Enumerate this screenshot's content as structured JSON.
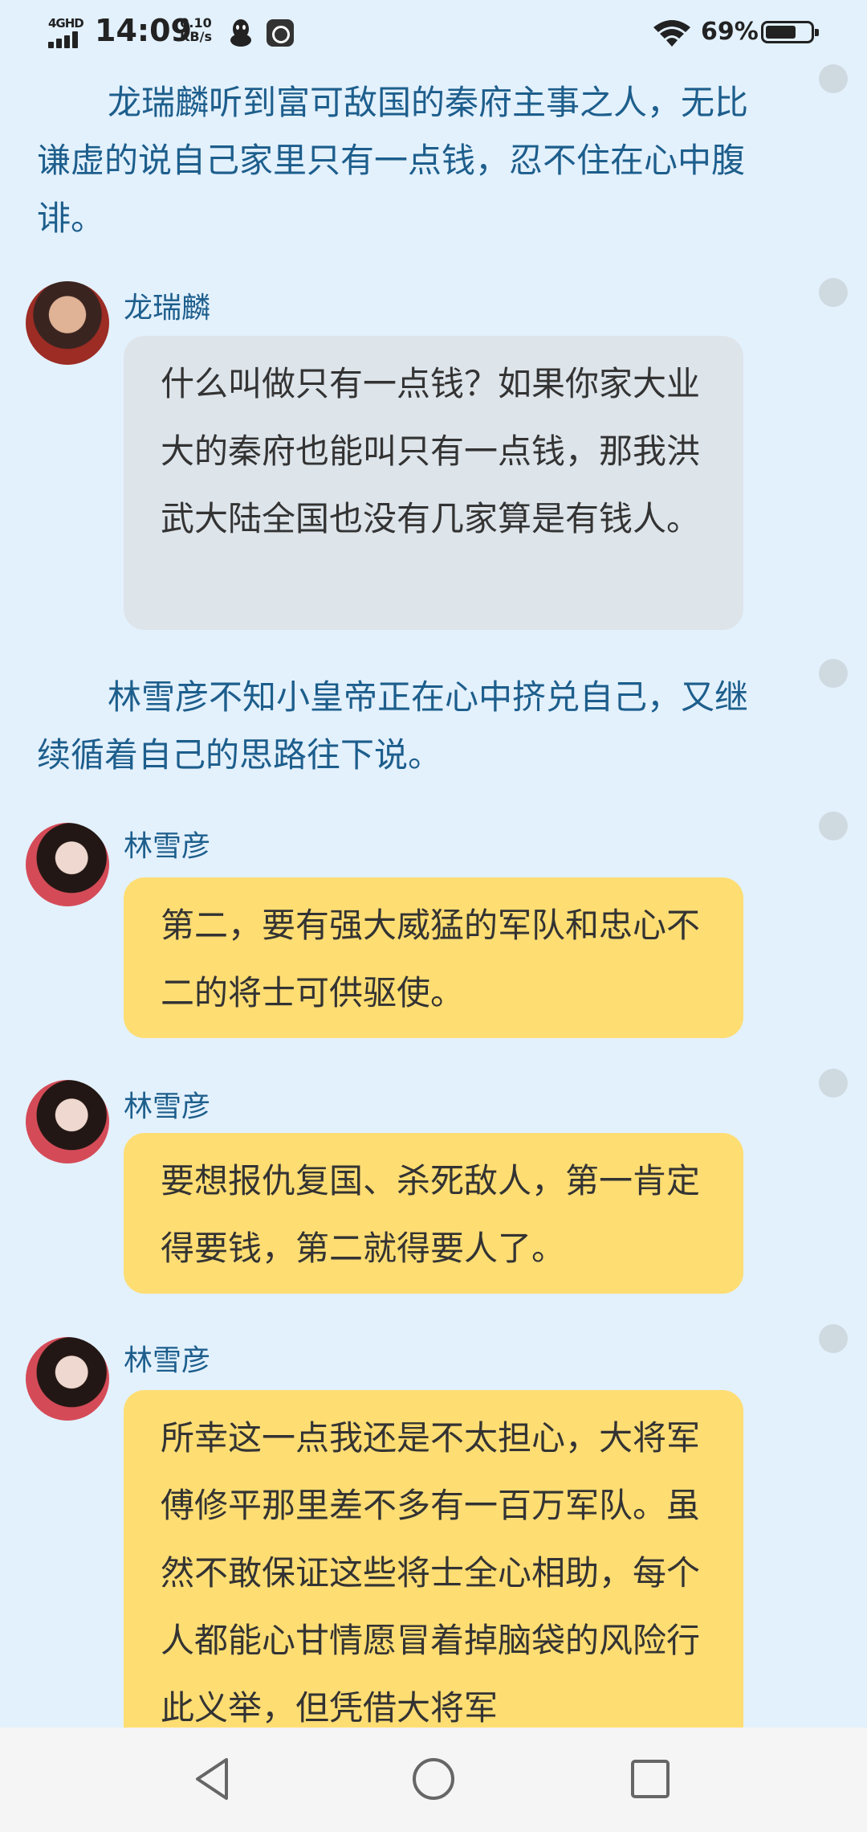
{
  "status_bar": {
    "network": "4GHD",
    "time": "14:09",
    "speed_value": "0.10",
    "speed_unit": "KB/s",
    "battery_percent": "69%",
    "battery_level": 0.69,
    "icons": [
      "signal-icon",
      "qq-icon",
      "app-notification-icon",
      "wifi-icon",
      "battery-icon"
    ]
  },
  "messages": [
    {
      "type": "narration",
      "text": "龙瑞麟听到富可敌国的秦府主事之人，无比谦虚的说自己家里只有一点钱，忍不住在心中腹诽。"
    },
    {
      "type": "dialogue",
      "speaker": "龙瑞麟",
      "style": "gray",
      "text": "什么叫做只有一点钱？如果你家大业大的秦府也能叫只有一点钱，那我洪武大陆全国也没有几家算是有钱人。"
    },
    {
      "type": "narration",
      "text": "林雪彦不知小皇帝正在心中挤兑自己，又继续循着自己的思路往下说。"
    },
    {
      "type": "dialogue",
      "speaker": "林雪彦",
      "style": "yellow",
      "text": "第二，要有强大威猛的军队和忠心不二的将士可供驱使。"
    },
    {
      "type": "dialogue",
      "speaker": "林雪彦",
      "style": "yellow",
      "text": "要想报仇复国、杀死敌人，第一肯定得要钱，第二就得要人了。"
    },
    {
      "type": "dialogue",
      "speaker": "林雪彦",
      "style": "yellow",
      "text": "所幸这一点我还是不太担心，大将军傅修平那里差不多有一百万军队。虽然不敢保证这些将士全心相助，每个人都能心甘情愿冒着掉脑袋的风险行此义举，但凭借大将军"
    }
  ],
  "colors": {
    "background": "#e3f1fd",
    "narration_text": "#1d5e8c",
    "gray_bubble": "#dde4ea",
    "yellow_bubble": "#fedd73",
    "navbar": "#f5f5f5"
  },
  "navbar": {
    "back": "back-triangle-icon",
    "home": "home-circle-icon",
    "recents": "recents-square-icon"
  }
}
